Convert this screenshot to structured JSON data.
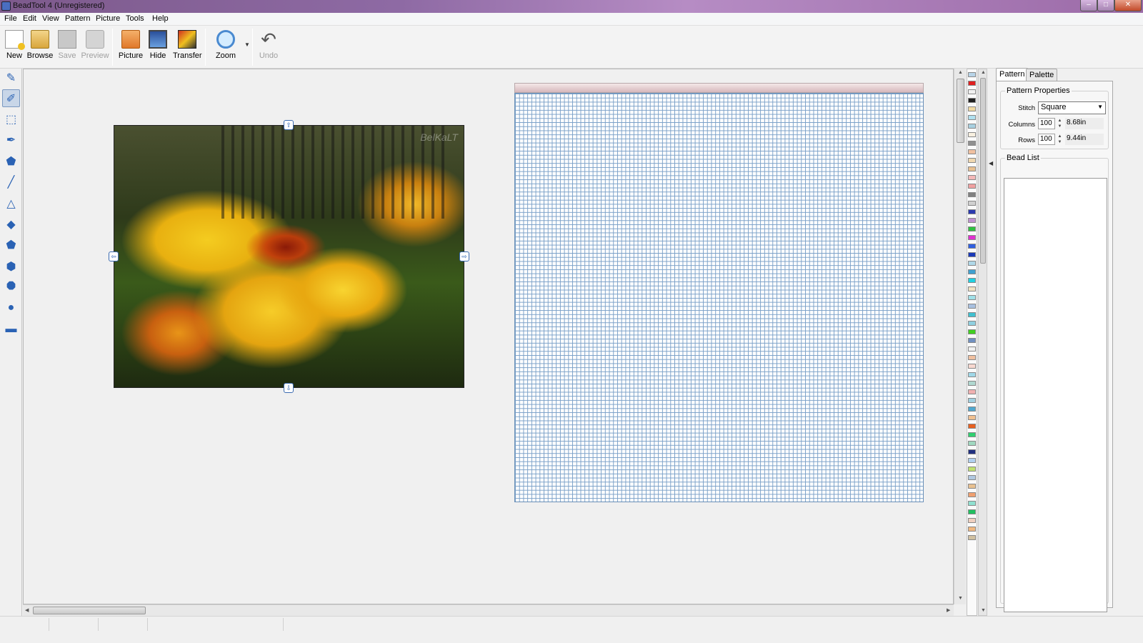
{
  "window": {
    "title": "BeadTool 4 (Unregistered)",
    "min": "–",
    "max": "□",
    "close": "✕"
  },
  "menu": [
    "File",
    "Edit",
    "View",
    "Pattern",
    "Picture",
    "Tools",
    "Help"
  ],
  "toolbar": {
    "new": "New",
    "browse": "Browse",
    "save": "Save",
    "preview": "Preview",
    "picture": "Picture",
    "hide": "Hide",
    "transfer": "Transfer",
    "zoom": "Zoom",
    "undo": "Undo"
  },
  "tools": [
    "pencil-icon",
    "line-pencil-icon",
    "select-rect-icon",
    "eyedropper-icon",
    "fill-icon",
    "line-icon",
    "triangle-icon",
    "diamond-icon",
    "pentagon-icon",
    "hexagon-icon",
    "octagon-icon",
    "circle-icon",
    "rectangle-icon"
  ],
  "photo": {
    "watermark": "BelKaLT"
  },
  "palette_colors": [
    "#b8d4e8",
    "#e02020",
    "#f0f0f0",
    "#202020",
    "#f0d8a0",
    "#b0e0f0",
    "#a8d0e0",
    "#f8f0e0",
    "#909090",
    "#f0c0a0",
    "#f0d8b0",
    "#e8c090",
    "#f4b8b8",
    "#f0a0a0",
    "#808080",
    "#d0d0d0",
    "#2a3ab0",
    "#c090d0",
    "#30c040",
    "#e030d0",
    "#3060e0",
    "#1a3ab8",
    "#b0d8e8",
    "#40a0d0",
    "#20d0e0",
    "#f0e0c0",
    "#a0e0e8",
    "#a8c0e0",
    "#40c0d0",
    "#90d0e0",
    "#40d020",
    "#7090c0",
    "#f0f0f0",
    "#f0c0a0",
    "#f8d8d0",
    "#a0d8e8",
    "#b0d8d0",
    "#f0b0b0",
    "#a0d0e0",
    "#50a8d0",
    "#f0c090",
    "#e86020",
    "#30d070",
    "#a0d8c0",
    "#203080",
    "#b0d0f0",
    "#c0e070",
    "#b0c8e0",
    "#e8c090",
    "#f0a070",
    "#90e0d0",
    "#20c060",
    "#f0d0c0",
    "#f0b880",
    "#d0c0a0"
  ],
  "panel": {
    "tabs": {
      "pattern": "Pattern",
      "palette": "Palette"
    },
    "properties": {
      "title": "Pattern Properties",
      "stitch_label": "Stitch",
      "stitch_value": "Square",
      "columns_label": "Columns",
      "columns_value": "100",
      "columns_size": "8.68in",
      "rows_label": "Rows",
      "rows_value": "100",
      "rows_size": "9.44in"
    },
    "beadlist_title": "Bead List"
  }
}
